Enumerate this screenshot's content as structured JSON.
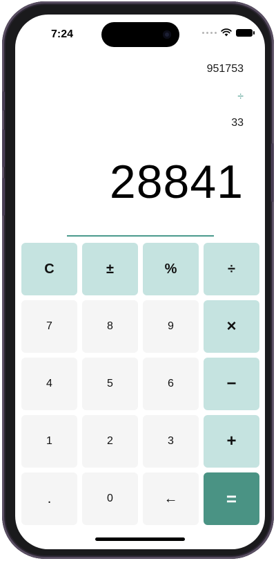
{
  "status_bar": {
    "time": "7:24"
  },
  "display": {
    "history_first": "951753",
    "history_operator": "÷",
    "history_second": "33",
    "result": "28841"
  },
  "keys": {
    "clear": "C",
    "plus_minus": "±",
    "percent": "%",
    "divide": "÷",
    "seven": "7",
    "eight": "8",
    "nine": "9",
    "multiply": "×",
    "four": "4",
    "five": "5",
    "six": "6",
    "minus": "−",
    "one": "1",
    "two": "2",
    "three": "3",
    "plus": "+",
    "decimal": ".",
    "zero": "0",
    "backspace": "←",
    "equals": "="
  },
  "colors": {
    "accent": "#4a9a8c",
    "function_key_bg": "#c5e3e0",
    "number_key_bg": "#f5f5f5",
    "equals_key_bg": "#4a9384"
  }
}
